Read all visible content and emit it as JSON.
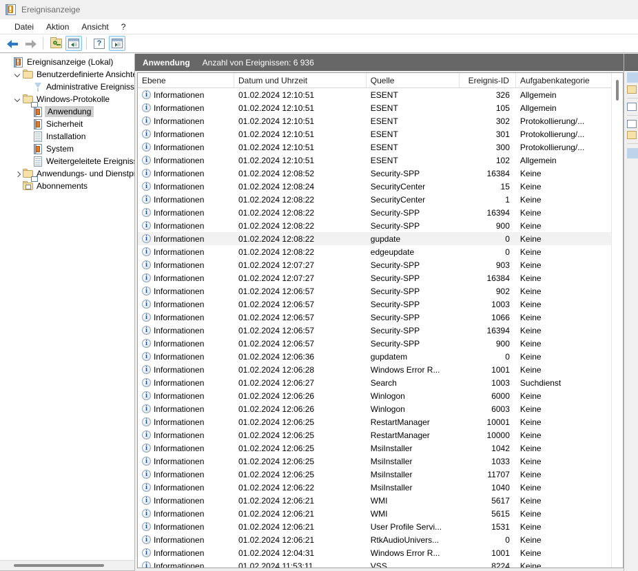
{
  "window": {
    "title": "Ereignisanzeige",
    "icon": "event-viewer-icon"
  },
  "menu": {
    "items": [
      {
        "label": "Datei",
        "name": "menu-datei"
      },
      {
        "label": "Aktion",
        "name": "menu-aktion"
      },
      {
        "label": "Ansicht",
        "name": "menu-ansicht"
      },
      {
        "label": "?",
        "name": "menu-hilfe"
      }
    ]
  },
  "toolbar": {
    "buttons": [
      {
        "name": "back-button",
        "icon": "arrow-left-icon"
      },
      {
        "name": "forward-button",
        "icon": "arrow-right-icon"
      },
      {
        "name": "show-hide-tree-button",
        "icon": "folder-key-icon"
      },
      {
        "name": "toggle-console-tree-button",
        "icon": "panel-left-icon"
      },
      {
        "name": "help-button",
        "icon": "question-mark-icon"
      },
      {
        "name": "toggle-action-pane-button",
        "icon": "panel-right-icon"
      }
    ]
  },
  "tree": {
    "items": [
      {
        "label": "Ereignisanzeige (Lokal)",
        "indent": 0,
        "twisty": "none",
        "icon": "event-viewer-book-icon",
        "selected": false
      },
      {
        "label": "Benutzerdefinierte Ansichten",
        "indent": 1,
        "twisty": "open",
        "icon": "custom-views-folder-icon",
        "selected": false
      },
      {
        "label": "Administrative Ereignisse",
        "indent": 2,
        "twisty": "none",
        "icon": "funnel-icon",
        "selected": false
      },
      {
        "label": "Windows-Protokolle",
        "indent": 1,
        "twisty": "open",
        "icon": "windows-logs-folder-icon",
        "selected": false
      },
      {
        "label": "Anwendung",
        "indent": 2,
        "twisty": "none",
        "icon": "event-log-icon",
        "selected": true
      },
      {
        "label": "Sicherheit",
        "indent": 2,
        "twisty": "none",
        "icon": "event-log-icon",
        "selected": false
      },
      {
        "label": "Installation",
        "indent": 2,
        "twisty": "none",
        "icon": "log-icon",
        "selected": false
      },
      {
        "label": "System",
        "indent": 2,
        "twisty": "none",
        "icon": "event-log-icon",
        "selected": false
      },
      {
        "label": "Weitergeleitete Ereignisse",
        "indent": 2,
        "twisty": "none",
        "icon": "log-icon",
        "selected": false
      },
      {
        "label": "Anwendungs- und Dienstprotokolle",
        "indent": 1,
        "twisty": "closed",
        "icon": "app-services-folder-icon",
        "selected": false
      },
      {
        "label": "Abonnements",
        "indent": 1,
        "twisty": "none",
        "icon": "subscriptions-folder-icon",
        "selected": false
      }
    ]
  },
  "main": {
    "header": {
      "title": "Anwendung",
      "count_label": "Anzahl von Ereignissen: 6 936"
    },
    "columns": [
      {
        "label": "Ebene",
        "key": "level",
        "align": "left"
      },
      {
        "label": "Datum und Uhrzeit",
        "key": "datetime",
        "align": "left"
      },
      {
        "label": "Quelle",
        "key": "source",
        "align": "left"
      },
      {
        "label": "Ereignis-ID",
        "key": "event_id",
        "align": "right"
      },
      {
        "label": "Aufgabenkategorie",
        "key": "category",
        "align": "left"
      }
    ],
    "rows": [
      {
        "level": "Informationen",
        "datetime": "01.02.2024 12:10:51",
        "source": "ESENT",
        "event_id": "326",
        "category": "Allgemein",
        "hover": false
      },
      {
        "level": "Informationen",
        "datetime": "01.02.2024 12:10:51",
        "source": "ESENT",
        "event_id": "105",
        "category": "Allgemein",
        "hover": false
      },
      {
        "level": "Informationen",
        "datetime": "01.02.2024 12:10:51",
        "source": "ESENT",
        "event_id": "302",
        "category": "Protokollierung/...",
        "hover": false
      },
      {
        "level": "Informationen",
        "datetime": "01.02.2024 12:10:51",
        "source": "ESENT",
        "event_id": "301",
        "category": "Protokollierung/...",
        "hover": false
      },
      {
        "level": "Informationen",
        "datetime": "01.02.2024 12:10:51",
        "source": "ESENT",
        "event_id": "300",
        "category": "Protokollierung/...",
        "hover": false
      },
      {
        "level": "Informationen",
        "datetime": "01.02.2024 12:10:51",
        "source": "ESENT",
        "event_id": "102",
        "category": "Allgemein",
        "hover": false
      },
      {
        "level": "Informationen",
        "datetime": "01.02.2024 12:08:52",
        "source": "Security-SPP",
        "event_id": "16384",
        "category": "Keine",
        "hover": false
      },
      {
        "level": "Informationen",
        "datetime": "01.02.2024 12:08:24",
        "source": "SecurityCenter",
        "event_id": "15",
        "category": "Keine",
        "hover": false
      },
      {
        "level": "Informationen",
        "datetime": "01.02.2024 12:08:22",
        "source": "SecurityCenter",
        "event_id": "1",
        "category": "Keine",
        "hover": false
      },
      {
        "level": "Informationen",
        "datetime": "01.02.2024 12:08:22",
        "source": "Security-SPP",
        "event_id": "16394",
        "category": "Keine",
        "hover": false
      },
      {
        "level": "Informationen",
        "datetime": "01.02.2024 12:08:22",
        "source": "Security-SPP",
        "event_id": "900",
        "category": "Keine",
        "hover": false
      },
      {
        "level": "Informationen",
        "datetime": "01.02.2024 12:08:22",
        "source": "gupdate",
        "event_id": "0",
        "category": "Keine",
        "hover": true
      },
      {
        "level": "Informationen",
        "datetime": "01.02.2024 12:08:22",
        "source": "edgeupdate",
        "event_id": "0",
        "category": "Keine",
        "hover": false
      },
      {
        "level": "Informationen",
        "datetime": "01.02.2024 12:07:27",
        "source": "Security-SPP",
        "event_id": "903",
        "category": "Keine",
        "hover": false
      },
      {
        "level": "Informationen",
        "datetime": "01.02.2024 12:07:27",
        "source": "Security-SPP",
        "event_id": "16384",
        "category": "Keine",
        "hover": false
      },
      {
        "level": "Informationen",
        "datetime": "01.02.2024 12:06:57",
        "source": "Security-SPP",
        "event_id": "902",
        "category": "Keine",
        "hover": false
      },
      {
        "level": "Informationen",
        "datetime": "01.02.2024 12:06:57",
        "source": "Security-SPP",
        "event_id": "1003",
        "category": "Keine",
        "hover": false
      },
      {
        "level": "Informationen",
        "datetime": "01.02.2024 12:06:57",
        "source": "Security-SPP",
        "event_id": "1066",
        "category": "Keine",
        "hover": false
      },
      {
        "level": "Informationen",
        "datetime": "01.02.2024 12:06:57",
        "source": "Security-SPP",
        "event_id": "16394",
        "category": "Keine",
        "hover": false
      },
      {
        "level": "Informationen",
        "datetime": "01.02.2024 12:06:57",
        "source": "Security-SPP",
        "event_id": "900",
        "category": "Keine",
        "hover": false
      },
      {
        "level": "Informationen",
        "datetime": "01.02.2024 12:06:36",
        "source": "gupdatem",
        "event_id": "0",
        "category": "Keine",
        "hover": false
      },
      {
        "level": "Informationen",
        "datetime": "01.02.2024 12:06:28",
        "source": "Windows Error R...",
        "event_id": "1001",
        "category": "Keine",
        "hover": false
      },
      {
        "level": "Informationen",
        "datetime": "01.02.2024 12:06:27",
        "source": "Search",
        "event_id": "1003",
        "category": "Suchdienst",
        "hover": false
      },
      {
        "level": "Informationen",
        "datetime": "01.02.2024 12:06:26",
        "source": "Winlogon",
        "event_id": "6000",
        "category": "Keine",
        "hover": false
      },
      {
        "level": "Informationen",
        "datetime": "01.02.2024 12:06:26",
        "source": "Winlogon",
        "event_id": "6003",
        "category": "Keine",
        "hover": false
      },
      {
        "level": "Informationen",
        "datetime": "01.02.2024 12:06:25",
        "source": "RestartManager",
        "event_id": "10001",
        "category": "Keine",
        "hover": false
      },
      {
        "level": "Informationen",
        "datetime": "01.02.2024 12:06:25",
        "source": "RestartManager",
        "event_id": "10000",
        "category": "Keine",
        "hover": false
      },
      {
        "level": "Informationen",
        "datetime": "01.02.2024 12:06:25",
        "source": "MsiInstaller",
        "event_id": "1042",
        "category": "Keine",
        "hover": false
      },
      {
        "level": "Informationen",
        "datetime": "01.02.2024 12:06:25",
        "source": "MsiInstaller",
        "event_id": "1033",
        "category": "Keine",
        "hover": false
      },
      {
        "level": "Informationen",
        "datetime": "01.02.2024 12:06:25",
        "source": "MsiInstaller",
        "event_id": "11707",
        "category": "Keine",
        "hover": false
      },
      {
        "level": "Informationen",
        "datetime": "01.02.2024 12:06:22",
        "source": "MsiInstaller",
        "event_id": "1040",
        "category": "Keine",
        "hover": false
      },
      {
        "level": "Informationen",
        "datetime": "01.02.2024 12:06:21",
        "source": "WMI",
        "event_id": "5617",
        "category": "Keine",
        "hover": false
      },
      {
        "level": "Informationen",
        "datetime": "01.02.2024 12:06:21",
        "source": "WMI",
        "event_id": "5615",
        "category": "Keine",
        "hover": false
      },
      {
        "level": "Informationen",
        "datetime": "01.02.2024 12:06:21",
        "source": "User Profile Servi...",
        "event_id": "1531",
        "category": "Keine",
        "hover": false
      },
      {
        "level": "Informationen",
        "datetime": "01.02.2024 12:06:21",
        "source": "RtkAudioUnivers...",
        "event_id": "0",
        "category": "Keine",
        "hover": false
      },
      {
        "level": "Informationen",
        "datetime": "01.02.2024 12:04:31",
        "source": "Windows Error R...",
        "event_id": "1001",
        "category": "Keine",
        "hover": false
      },
      {
        "level": "Informationen",
        "datetime": "01.02.2024 11:53:11",
        "source": "VSS",
        "event_id": "8224",
        "category": "Keine",
        "hover": false
      }
    ]
  },
  "colors": {
    "header_bar": "#676767",
    "selection": "#cfcfcf",
    "hover_row": "#f2f2f2",
    "info_icon_text": "#1b4f9c",
    "chrome": "#f0f0f0"
  }
}
